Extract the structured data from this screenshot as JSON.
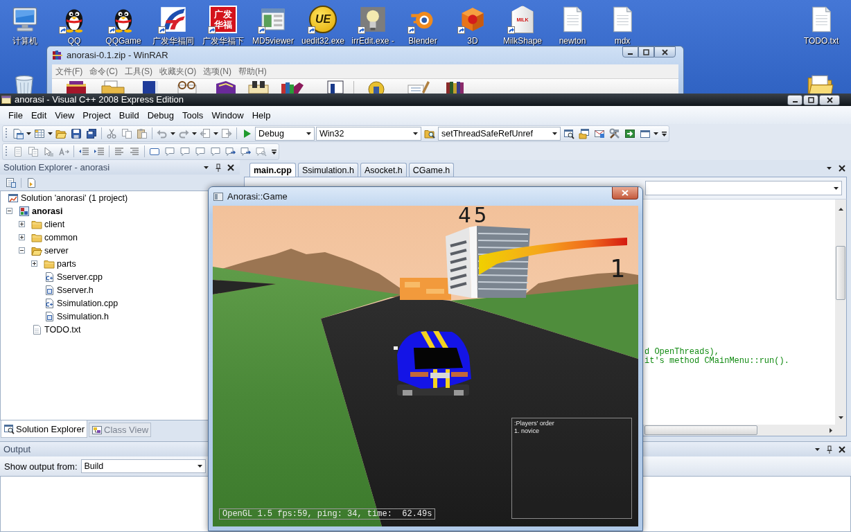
{
  "desktop": {
    "icons": [
      {
        "kind": "computer",
        "label": "计算机",
        "shortcut": false
      },
      {
        "kind": "penguin",
        "label": "QQ",
        "shortcut": true
      },
      {
        "kind": "penguin",
        "label": "QQGame",
        "shortcut": true
      },
      {
        "kind": "swirl",
        "label": "广发华福同",
        "shortcut": true
      },
      {
        "kind": "tile",
        "logo_text": "广发华福",
        "label": "广发华福下",
        "shortcut": true
      },
      {
        "kind": "window",
        "label": "MD5viewer",
        "shortcut": true
      },
      {
        "kind": "badge",
        "logo_text": "UE",
        "label": "uedit32.exe",
        "shortcut": true
      },
      {
        "kind": "bulb",
        "label": "irrEdit.exe -",
        "shortcut": true
      },
      {
        "kind": "blender",
        "label": "Blender",
        "shortcut": true
      },
      {
        "kind": "cube",
        "label": "3D",
        "shortcut": true
      },
      {
        "kind": "carton",
        "logo_text": "MILK",
        "label": "MilkShape",
        "shortcut": true
      },
      {
        "kind": "document",
        "label": "newton",
        "shortcut": false
      },
      {
        "kind": "document",
        "label": "mdx",
        "shortcut": false
      },
      {
        "kind": "document",
        "label": "TODO.txt",
        "shortcut": false
      },
      {
        "kind": "recycle",
        "shortcut": false
      },
      {
        "kind": "folder",
        "shortcut": false
      }
    ]
  },
  "winrar": {
    "title": "anorasi-0.1.zip - WinRAR",
    "menu": [
      "文件(F)",
      "命令(C)",
      "工具(S)",
      "收藏夹(O)",
      "选项(N)",
      "帮助(H)"
    ]
  },
  "ide": {
    "title": "anorasi - Visual C++ 2008 Express Edition",
    "menu": [
      "File",
      "Edit",
      "View",
      "Project",
      "Build",
      "Debug",
      "Tools",
      "Window",
      "Help"
    ],
    "toolbar": {
      "configuration": "Debug",
      "platform": "Win32",
      "find": "setThreadSafeRefUnref"
    },
    "solution_explorer": {
      "title": "Solution Explorer - anorasi",
      "tree": [
        {
          "label": "Solution 'anorasi' (1 project)",
          "kind": "solution",
          "children": [
            {
              "label": "anorasi",
              "kind": "project",
              "expanded": true,
              "children": [
                {
                  "label": "client",
                  "kind": "folder",
                  "expanded": false
                },
                {
                  "label": "common",
                  "kind": "folder",
                  "expanded": false
                },
                {
                  "label": "server",
                  "kind": "folder",
                  "expanded": true,
                  "children": [
                    {
                      "label": "parts",
                      "kind": "folder",
                      "expanded": false
                    },
                    {
                      "label": "Sserver.cpp",
                      "kind": "cpp"
                    },
                    {
                      "label": "Sserver.h",
                      "kind": "header"
                    },
                    {
                      "label": "Ssimulation.cpp",
                      "kind": "cpp"
                    },
                    {
                      "label": "Ssimulation.h",
                      "kind": "header"
                    }
                  ]
                },
                {
                  "label": "TODO.txt",
                  "kind": "text"
                }
              ]
            }
          ]
        }
      ],
      "tabs": [
        {
          "label": "Solution Explorer",
          "selected": true
        },
        {
          "label": "Class View",
          "selected": false
        }
      ]
    },
    "editor": {
      "tabs": [
        {
          "label": "main.cpp",
          "selected": true
        },
        {
          "label": "Ssimulation.h",
          "selected": false
        },
        {
          "label": "Asocket.h",
          "selected": false
        },
        {
          "label": "CGame.h",
          "selected": false
        }
      ],
      "code_lines": [
        "d OpenThreads),",
        "it's method CMainMenu::run()."
      ]
    },
    "output": {
      "title": "Output",
      "source_label": "Show output from:",
      "source": "Build"
    }
  },
  "game_window": {
    "title": "Anorasi::Game",
    "hud": {
      "top_number": "45",
      "right_number": "1",
      "players_title": ":Players' order",
      "players": [
        "1. novice"
      ],
      "status": "OpenGL 1.5 fps:59, ping: 34, time:  62.49s"
    }
  }
}
